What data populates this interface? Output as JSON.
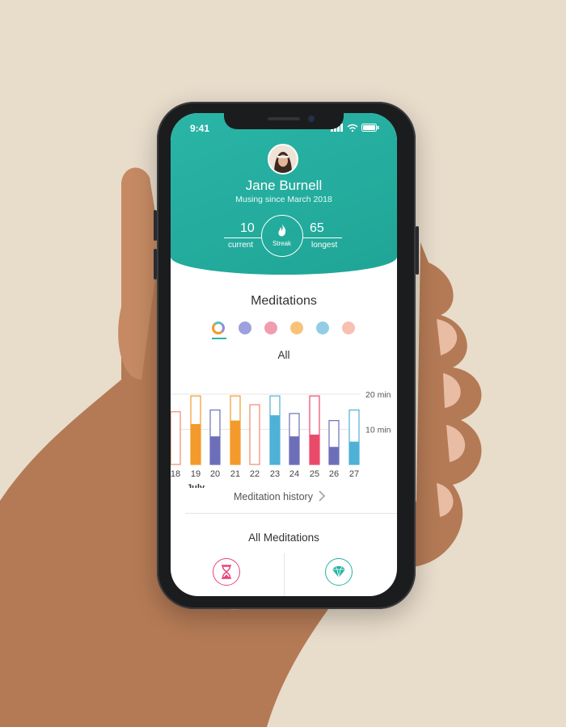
{
  "status": {
    "time": "9:41"
  },
  "profile": {
    "name": "Jane Burnell",
    "since": "Musing since March 2018"
  },
  "streak": {
    "label": "Streak",
    "current_value": "10",
    "current_label": "current",
    "longest_value": "65",
    "longest_label": "longest"
  },
  "meditations": {
    "title": "Meditations",
    "filter_label": "All",
    "categories": [
      {
        "name": "all-icon",
        "color": "#f39a2a"
      },
      {
        "name": "brain-icon",
        "color": "#8b8fd6"
      },
      {
        "name": "heart-icon",
        "color": "#f08ba2"
      },
      {
        "name": "stack-icon",
        "color": "#f6b860"
      },
      {
        "name": "lungs-icon",
        "color": "#7fc4e0"
      },
      {
        "name": "clock-icon",
        "color": "#f4b6a6"
      }
    ],
    "history_link": "Meditation history"
  },
  "chart_data": {
    "type": "bar",
    "categories": [
      "18",
      "19",
      "20",
      "21",
      "22",
      "23",
      "24",
      "25",
      "26",
      "27"
    ],
    "month_label": "July",
    "y_tick_labels": [
      "20 min",
      "10 min"
    ],
    "ylim": [
      0,
      20
    ],
    "goal_values": [
      15,
      19.5,
      15.5,
      19.5,
      17,
      19.5,
      14.5,
      19.5,
      12.5,
      15.5
    ],
    "values": [
      0,
      11.5,
      8,
      12.5,
      0,
      14,
      8,
      8.5,
      5,
      6.5
    ],
    "colors": [
      "#f08a6a",
      "#f39a2a",
      "#6c6fb8",
      "#f39a2a",
      "#f08a6a",
      "#4fb1d6",
      "#6c6fb8",
      "#ea4a6a",
      "#6c6fb8",
      "#4fb1d6"
    ]
  },
  "all_meditations": {
    "title": "All Meditations",
    "items": [
      {
        "name": "hourglass-icon",
        "color": "#e6457a"
      },
      {
        "name": "diamond-icon",
        "color": "#23b3a4"
      }
    ]
  }
}
